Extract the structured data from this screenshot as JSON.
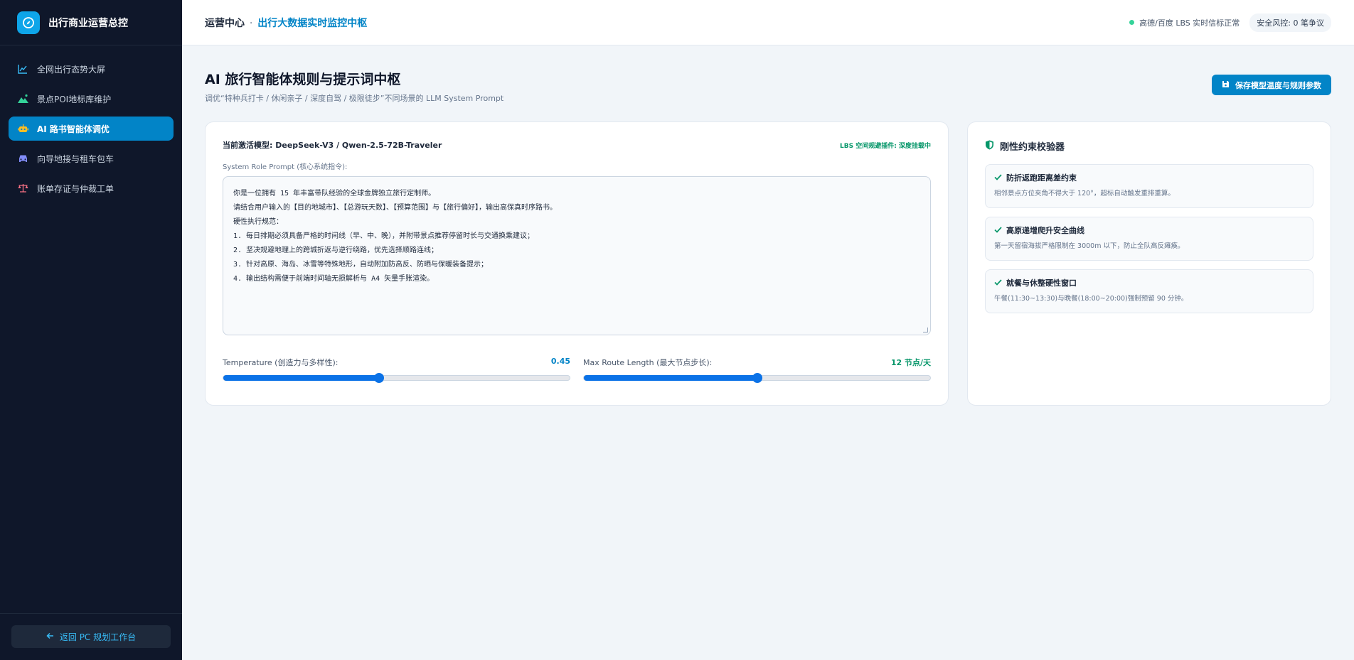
{
  "brand": {
    "title": "出行商业运营总控"
  },
  "nav": {
    "items": [
      {
        "label": "全网出行态势大屏",
        "icon": "chart-line-icon"
      },
      {
        "label": "景点POI地标库维护",
        "icon": "mountain-icon"
      },
      {
        "label": "AI 路书智能体调优",
        "icon": "robot-icon",
        "active": true
      },
      {
        "label": "向导地接与租车包车",
        "icon": "car-icon"
      },
      {
        "label": "账单存证与仲裁工单",
        "icon": "scale-icon"
      }
    ],
    "back_label": "返回 PC 规划工作台"
  },
  "header": {
    "crumb_root": "运营中心",
    "crumb_sep": "·",
    "crumb_current": "出行大数据实时监控中枢",
    "status_text": "高德/百度 LBS 实时信标正常",
    "risk_text": "安全风控: 0 笔争议"
  },
  "page": {
    "title": "AI 旅行智能体规则与提示词中枢",
    "subtitle": "调优“特种兵打卡 / 休闲亲子 / 深度自驾 / 极限徒步”不同场景的 LLM System Prompt",
    "save_label": "保存模型温度与规则参数"
  },
  "editor": {
    "model_label": "当前激活模型: DeepSeek-V3 / Qwen-2.5-72B-Traveler",
    "plugin_label": "LBS 空间规避插件: 深度挂载中",
    "prompt_label": "System Role Prompt (核心系统指令):",
    "prompt_lines": [
      "你是一位拥有 15 年丰富带队经验的全球金牌独立旅行定制师。",
      "请结合用户输入的【目的地城市】、【总游玩天数】、【预算范围】与【旅行偏好】，输出高保真时序路书。",
      "硬性执行规范：",
      "1. 每日排期必须具备严格的时间线（早、中、晚），并附带景点推荐停留时长与交通换乘建议；",
      "2. 坚决规避地理上的跨城折返与逆行绕路，优先选择顺路连线；",
      "3. 针对高原、海岛、冰雪等特殊地形，自动附加防高反、防晒与保暖装备提示；",
      "4. 输出结构需便于前端时间轴无损解析与 A4 矢量手账渲染。"
    ],
    "temperature": {
      "label": "Temperature (创造力与多样性):",
      "value": "0.45",
      "fraction": 0.45
    },
    "route_length": {
      "label": "Max Route Length (最大节点步长):",
      "value": "12 节点/天",
      "fraction": 0.5
    }
  },
  "validator": {
    "title": "刚性约束校验器",
    "rules": [
      {
        "title": "防折返跑距离差约束",
        "desc": "相邻景点方位夹角不得大于 120°，超标自动触发重排重算。"
      },
      {
        "title": "高原递增爬升安全曲线",
        "desc": "第一天留宿海拔严格限制在 3000m 以下，防止全队高反瘫痪。"
      },
      {
        "title": "就餐与休整硬性窗口",
        "desc": "午餐(11:30~13:30)与晚餐(18:00~20:00)强制预留 90 分钟。"
      }
    ]
  },
  "colors": {
    "accent": "#0284c7",
    "sidebar": "#0f172a",
    "success": "#059669"
  }
}
